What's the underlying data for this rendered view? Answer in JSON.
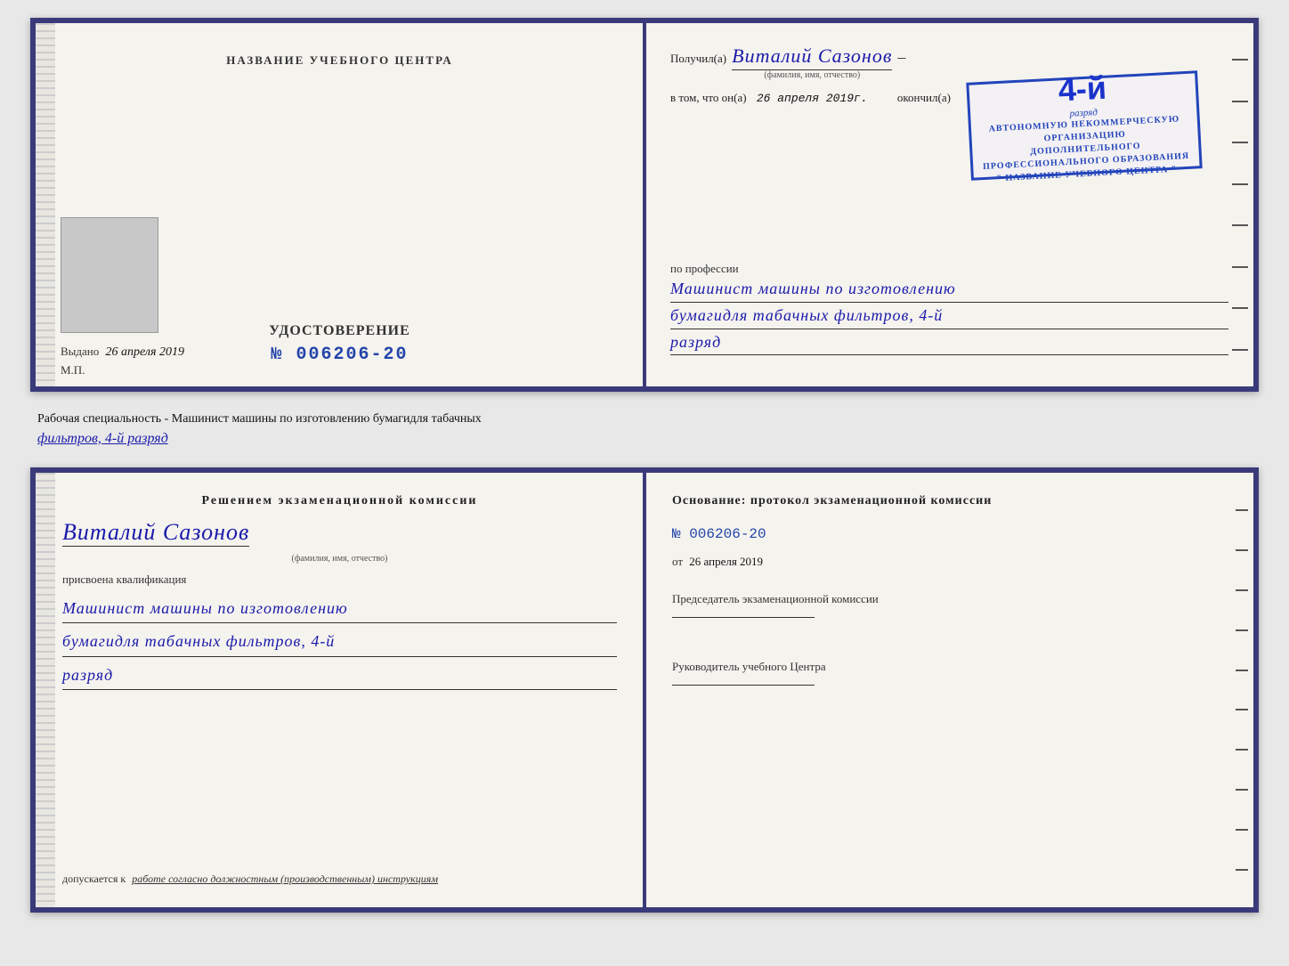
{
  "top_doc": {
    "left": {
      "center_title": "НАЗВАНИЕ УЧЕБНОГО ЦЕНТРА",
      "cert_label": "УДОСТОВЕРЕНИЕ",
      "cert_number": "№ 006206-20",
      "issued_label": "Выдано",
      "issued_date": "26 апреля 2019",
      "mp_label": "М.П."
    },
    "right": {
      "received_label": "Получил(а)",
      "recipient_name": "Виталий Сазонов",
      "name_sub": "(фамилия, имя, отчество)",
      "in_that_label": "в том, что он(а)",
      "date_label": "26 апреля 2019г.",
      "finished_label": "окончил(а)",
      "stamp_number": "4-й",
      "stamp_rank": "разряд",
      "stamp_line1": "АВТОНОМНУЮ НЕКОММЕРЧЕСКУЮ ОРГАНИЗАЦИЮ",
      "stamp_line2": "ДОПОЛНИТЕЛЬНОГО ПРОФЕССИОНАЛЬНОГО ОБРАЗОВАНИЯ",
      "stamp_line3": "\" НАЗВАНИЕ УЧЕБНОГО ЦЕНТРА \"",
      "profession_label": "по профессии",
      "profession_line1": "Машинист машины по изготовлению",
      "profession_line2": "бумагидля табачных фильтров, 4-й",
      "profession_line3": "разряд"
    }
  },
  "middle": {
    "text_prefix": "Рабочая специальность - Машинист машины по изготовлению бумагидля табачных",
    "text_underline": "фильтров, 4-й разряд"
  },
  "bottom_doc": {
    "left": {
      "title": "Решением  экзаменационной  комиссии",
      "name": "Виталий Сазонов",
      "name_sub": "(фамилия, имя, отчество)",
      "assigned_label": "присвоена квалификация",
      "profession_line1": "Машинист машины по изготовлению",
      "profession_line2": "бумагидля табачных фильтров, 4-й",
      "profession_line3": "разряд",
      "allowed_label": "допускается к",
      "allowed_italic": "работе согласно должностным (производственным) инструкциям"
    },
    "right": {
      "basis_label": "Основание: протокол экзаменационной  комиссии",
      "protocol_number": "№  006206-20",
      "date_prefix": "от",
      "date_value": "26 апреля 2019",
      "chairman_label": "Председатель экзаменационной комиссии",
      "head_label": "Руководитель учебного Центра"
    }
  }
}
